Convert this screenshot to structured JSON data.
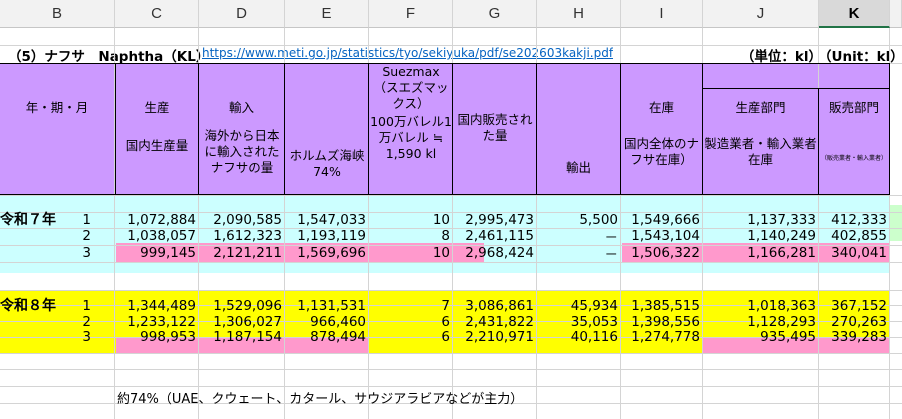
{
  "columns": [
    "B",
    "C",
    "D",
    "E",
    "F",
    "G",
    "H",
    "I",
    "J",
    "K"
  ],
  "selected_column": "K",
  "title": {
    "label": "（5）ナフサ　Naphtha（KL）",
    "url": "https://www.meti.go.jp/statistics/tyo/sekiyuka/pdf/se202603kakji.pdf",
    "unit_jp": "（単位：kl）",
    "unit_en": "（Unit：kl）"
  },
  "headers": {
    "period": "年・期・月",
    "production": "生産",
    "production_sub": "国内生産量",
    "imports": "輸入",
    "imports_sub": "海外から日本に輸入されたナフサの量",
    "hormuz": "ホルムズ海峡　74%",
    "suezmax": "Suezmax（スエズマックス）",
    "suezmax_sub": "100万バレル1万バレル ≒ 1,590 kl",
    "domestic_sales": "国内販売された量",
    "exports": "輸出",
    "inventory": "在庫",
    "inventory_sub": "国内全体のナフサ在庫）",
    "producer": "生産部門",
    "producer_sub": "製造業者・輸入業者 在庫",
    "sales_dept": "販売部門",
    "sales_dept_sub": "（販売業者・輸入業者）"
  },
  "groups": [
    {
      "era": "令和７年",
      "rows": [
        {
          "month": "1",
          "production": "1,072,884",
          "imports": "2,090,585",
          "hormuz": "1,547,033",
          "suezmax": "10",
          "domestic": "2,995,473",
          "exports": "5,500",
          "inventory": "1,549,666",
          "producer": "1,137,333",
          "sales": "412,333"
        },
        {
          "month": "2",
          "production": "1,038,057",
          "imports": "1,612,323",
          "hormuz": "1,193,119",
          "suezmax": "8",
          "domestic": "2,461,115",
          "exports": "－",
          "inventory": "1,543,104",
          "producer": "1,140,249",
          "sales": "402,855"
        },
        {
          "month": "3",
          "production": "999,145",
          "imports": "2,121,211",
          "hormuz": "1,569,696",
          "suezmax": "10",
          "domestic": "2,968,424",
          "exports": "－",
          "inventory": "1,506,322",
          "producer": "1,166,281",
          "sales": "340,041"
        }
      ]
    },
    {
      "era": "令和８年",
      "rows": [
        {
          "month": "1",
          "production": "1,344,489",
          "imports": "1,529,096",
          "hormuz": "1,131,531",
          "suezmax": "7",
          "domestic": "3,086,861",
          "exports": "45,934",
          "inventory": "1,385,515",
          "producer": "1,018,363",
          "sales": "367,152"
        },
        {
          "month": "2",
          "production": "1,233,122",
          "imports": "1,306,027",
          "hormuz": "966,460",
          "suezmax": "6",
          "domestic": "2,431,822",
          "exports": "35,053",
          "inventory": "1,398,556",
          "producer": "1,128,293",
          "sales": "270,263"
        },
        {
          "month": "3",
          "production": "998,953",
          "imports": "1,187,154",
          "hormuz": "878,494",
          "suezmax": "6",
          "domestic": "2,210,971",
          "exports": "40,116",
          "inventory": "1,274,778",
          "producer": "935,495",
          "sales": "339,283"
        }
      ]
    }
  ],
  "footnote": "約74%（UAE、クウェート、カタール、サウジアラビアなどが主力）",
  "colors": {
    "header_bg": "#cc99ff",
    "cyan": "#ccffff",
    "yellow": "#ffff00",
    "pink": "#ff99cc",
    "green": "#ccffcc"
  }
}
